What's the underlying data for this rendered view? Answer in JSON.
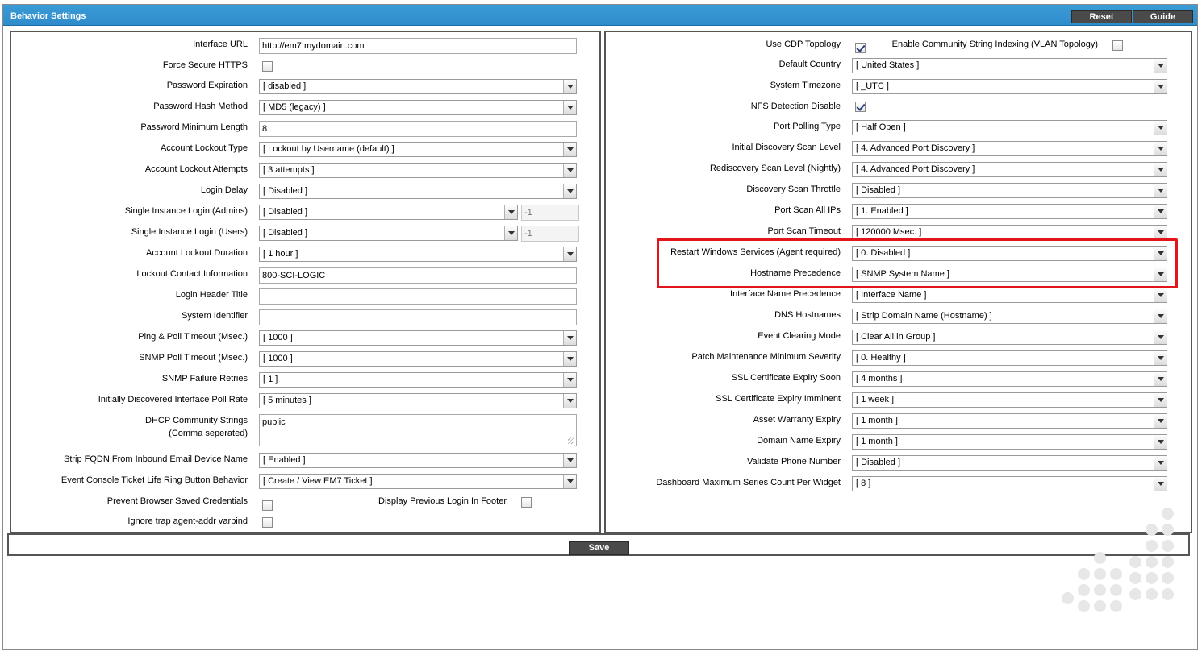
{
  "title": "Behavior Settings",
  "header_buttons": {
    "reset": "Reset",
    "guide": "Guide"
  },
  "save_label": "Save",
  "left": {
    "interface_url": {
      "label": "Interface URL",
      "value": "http://em7.mydomain.com"
    },
    "force_https": {
      "label": "Force Secure HTTPS",
      "checked": false
    },
    "password_expiration": {
      "label": "Password Expiration",
      "value": "[ disabled ]"
    },
    "password_hash": {
      "label": "Password Hash Method",
      "value": "[ MD5 (legacy) ]"
    },
    "password_min_length": {
      "label": "Password Minimum Length",
      "value": "8"
    },
    "lockout_type": {
      "label": "Account Lockout Type",
      "value": "[ Lockout by Username (default) ]"
    },
    "lockout_attempts": {
      "label": "Account Lockout Attempts",
      "value": "[ 3 attempts ]"
    },
    "login_delay": {
      "label": "Login Delay",
      "value": "[ Disabled ]"
    },
    "single_admins": {
      "label": "Single Instance Login (Admins)",
      "value": "[ Disabled ]",
      "extra": "-1"
    },
    "single_users": {
      "label": "Single Instance Login (Users)",
      "value": "[ Disabled ]",
      "extra": "-1"
    },
    "lockout_duration": {
      "label": "Account Lockout Duration",
      "value": "[ 1 hour ]"
    },
    "lockout_contact": {
      "label": "Lockout Contact Information",
      "value": "800-SCI-LOGIC"
    },
    "login_header": {
      "label": "Login Header Title",
      "value": ""
    },
    "system_identifier": {
      "label": "System Identifier",
      "value": ""
    },
    "ping_timeout": {
      "label": "Ping & Poll Timeout (Msec.)",
      "value": "[ 1000 ]"
    },
    "snmp_timeout": {
      "label": "SNMP Poll Timeout (Msec.)",
      "value": "[ 1000 ]"
    },
    "snmp_retries": {
      "label": "SNMP Failure Retries",
      "value": "[ 1 ]"
    },
    "iface_poll_rate": {
      "label": "Initially Discovered Interface Poll Rate",
      "value": "[ 5 minutes ]"
    },
    "dhcp_community": {
      "label": "DHCP Community Strings",
      "label2": "(Comma seperated)",
      "value": "public"
    },
    "strip_fqdn": {
      "label": "Strip FQDN From Inbound Email Device Name",
      "value": "[ Enabled ]"
    },
    "ticket_ring": {
      "label": "Event Console Ticket Life Ring Button Behavior",
      "value": "[ Create / View EM7 Ticket ]"
    },
    "prevent_saved": {
      "label": "Prevent Browser Saved Credentials",
      "checked": false
    },
    "display_prev_login": {
      "label": "Display Previous Login In Footer",
      "checked": false
    },
    "ignore_trap": {
      "label": "Ignore trap agent-addr varbind",
      "checked": false
    }
  },
  "right": {
    "cdp": {
      "label": "Use CDP Topology",
      "checked": true
    },
    "community_index": {
      "label": "Enable Community String Indexing (VLAN Topology)",
      "checked": false
    },
    "default_country": {
      "label": "Default Country",
      "value": "[ United States ]"
    },
    "timezone": {
      "label": "System Timezone",
      "value": "[ _UTC ]"
    },
    "nfs_disable": {
      "label": "NFS Detection Disable",
      "checked": true
    },
    "port_polling": {
      "label": "Port Polling Type",
      "value": "[ Half Open ]"
    },
    "initial_scan": {
      "label": "Initial Discovery Scan Level",
      "value": "[ 4. Advanced Port Discovery ]"
    },
    "rediscovery_scan": {
      "label": "Rediscovery Scan Level (Nightly)",
      "value": "[ 4. Advanced Port Discovery ]"
    },
    "scan_throttle": {
      "label": "Discovery Scan Throttle",
      "value": "[ Disabled ]"
    },
    "port_scan_all": {
      "label": "Port Scan All IPs",
      "value": "[ 1. Enabled ]"
    },
    "port_scan_timeout": {
      "label": "Port Scan Timeout",
      "value": "[ 120000 Msec. ]"
    },
    "restart_windows": {
      "label": "Restart Windows Services (Agent required)",
      "value": "[ 0. Disabled ]"
    },
    "hostname_precedence": {
      "label": "Hostname Precedence",
      "value": "[ SNMP System Name ]"
    },
    "iface_name_precedence": {
      "label": "Interface Name Precedence",
      "value": "[ Interface Name ]"
    },
    "dns_hostnames": {
      "label": "DNS Hostnames",
      "value": "[ Strip Domain Name (Hostname) ]"
    },
    "event_clearing": {
      "label": "Event Clearing Mode",
      "value": "[ Clear All in Group ]"
    },
    "patch_severity": {
      "label": "Patch Maintenance Minimum Severity",
      "value": "[ 0. Healthy ]"
    },
    "ssl_soon": {
      "label": "SSL Certificate Expiry Soon",
      "value": "[ 4 months ]"
    },
    "ssl_imminent": {
      "label": "SSL Certificate Expiry Imminent",
      "value": "[ 1 week ]"
    },
    "asset_warranty": {
      "label": "Asset Warranty Expiry",
      "value": "[ 1 month ]"
    },
    "domain_expiry": {
      "label": "Domain Name Expiry",
      "value": "[ 1 month ]"
    },
    "validate_phone": {
      "label": "Validate Phone Number",
      "value": "[ Disabled ]"
    },
    "dash_max_series": {
      "label": "Dashboard Maximum Series Count Per Widget",
      "value": "[ 8 ]"
    }
  },
  "colors": {
    "titlebar": "#3a9bd6",
    "highlight": "#e3151a",
    "button": "#4a4a4a"
  }
}
